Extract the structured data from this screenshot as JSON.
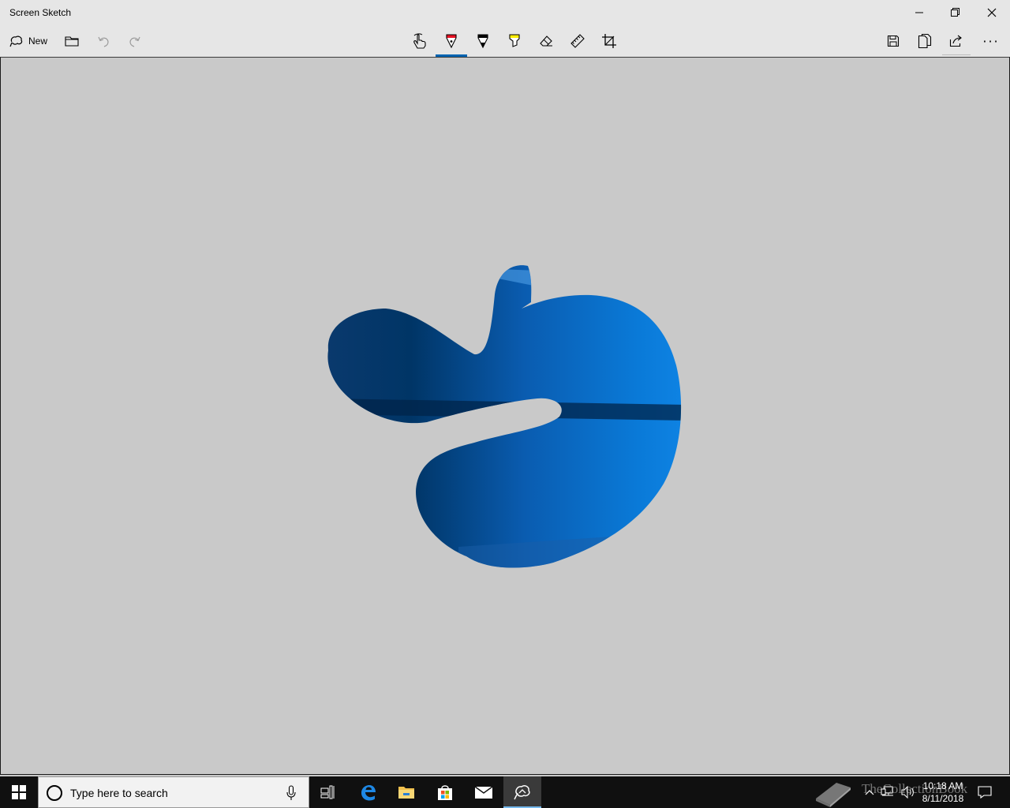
{
  "window": {
    "title": "Screen Sketch"
  },
  "toolbar": {
    "new_label": "New",
    "more_label": "···"
  },
  "taskbar": {
    "search_placeholder": "Type here to search",
    "watermark": "TheCollectionBook",
    "clock_time": "10:18 AM",
    "clock_date": "8/11/2018"
  },
  "colors": {
    "accent": "#0063b1",
    "canvas_bg": "#c9c9c9",
    "chrome_bg": "#e6e6e6",
    "taskbar_bg": "#101010",
    "pen_red": "#e81123",
    "highlighter_yellow": "#ffee00"
  },
  "icons": {
    "new": "new-snip-icon",
    "open": "folder-icon",
    "undo": "undo-icon",
    "redo": "redo-icon",
    "touch": "touch-writing-icon",
    "pen": "ballpoint-pen-icon",
    "pencil": "pencil-icon",
    "highlighter": "highlighter-icon",
    "eraser": "eraser-icon",
    "ruler": "ruler-icon",
    "crop": "crop-icon",
    "save": "save-icon",
    "copy": "copy-icon",
    "share": "share-icon"
  }
}
